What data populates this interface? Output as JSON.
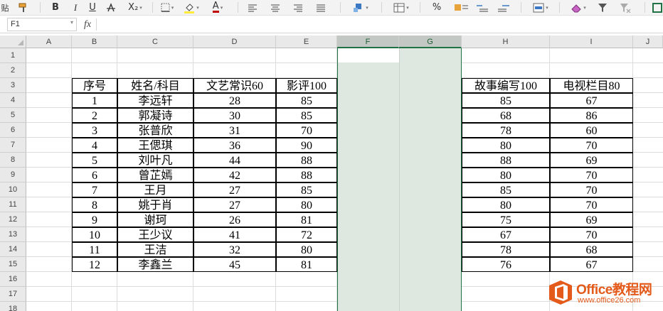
{
  "ribbon": {
    "paste_label": "贴",
    "bold": "B",
    "italic": "I",
    "underline": "U",
    "font_size_icon": "A",
    "subscript": "X₂",
    "font_color": "A",
    "percent": "%",
    "accent_color": "#c00000"
  },
  "formula_bar": {
    "name_box": "F1",
    "fx_label": "fx",
    "formula": ""
  },
  "columns": [
    "A",
    "B",
    "C",
    "D",
    "E",
    "F",
    "G",
    "H",
    "I",
    "J"
  ],
  "selected_columns": [
    "F",
    "G"
  ],
  "rows": [
    "1",
    "2",
    "3",
    "4",
    "5",
    "6",
    "7",
    "8",
    "9",
    "10",
    "11",
    "12",
    "13",
    "14",
    "15",
    "16",
    "17",
    "18"
  ],
  "table": {
    "headers": [
      "序号",
      "姓名/科目",
      "文艺常识60",
      "影评100",
      "故事编写100",
      "电视栏目80"
    ],
    "rows": [
      [
        "1",
        "李远轩",
        "28",
        "85",
        "85",
        "67"
      ],
      [
        "2",
        "郭凝诗",
        "30",
        "85",
        "68",
        "86"
      ],
      [
        "3",
        "张普欣",
        "31",
        "70",
        "78",
        "60"
      ],
      [
        "4",
        "王偲琪",
        "36",
        "90",
        "80",
        "70"
      ],
      [
        "5",
        "刘叶凡",
        "44",
        "88",
        "88",
        "69"
      ],
      [
        "6",
        "曾芷嫣",
        "42",
        "88",
        "80",
        "70"
      ],
      [
        "7",
        "王月",
        "27",
        "85",
        "85",
        "70"
      ],
      [
        "8",
        "姚于肖",
        "27",
        "80",
        "80",
        "70"
      ],
      [
        "9",
        "谢珂",
        "26",
        "81",
        "75",
        "69"
      ],
      [
        "10",
        "王少议",
        "41",
        "72",
        "67",
        "70"
      ],
      [
        "11",
        "王洁",
        "32",
        "80",
        "78",
        "68"
      ],
      [
        "12",
        "李鑫兰",
        "45",
        "81",
        "76",
        "67"
      ]
    ]
  },
  "watermark": {
    "name": "Office教程网",
    "url": "www.office26.com",
    "color": "#e35a1a"
  },
  "colors": {
    "selection_border": "#217346",
    "selection_fill": "#dfe7e1"
  }
}
